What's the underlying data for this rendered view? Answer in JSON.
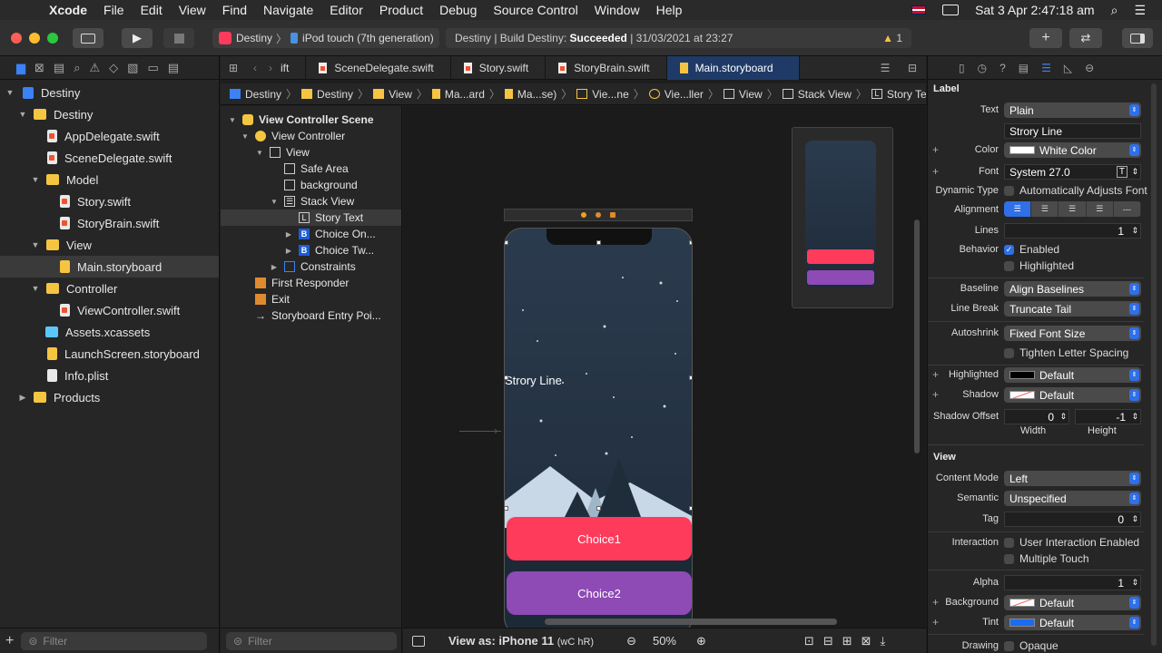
{
  "menu": {
    "app": "Xcode",
    "items": [
      "File",
      "Edit",
      "View",
      "Find",
      "Navigate",
      "Editor",
      "Product",
      "Debug",
      "Source Control",
      "Window",
      "Help"
    ],
    "clock": "Sat 3 Apr  2:47:18 am"
  },
  "toolbar": {
    "scheme": "Destiny",
    "device": "iPod touch (7th generation)",
    "status_prefix": "Destiny | Build Destiny: ",
    "status_bold": "Succeeded",
    "status_suffix": " | 31/03/2021 at 23:27",
    "warnings": "1"
  },
  "navigator": {
    "rows": [
      {
        "label": "Destiny",
        "level": 0,
        "icon": "xcodeproj",
        "open": true
      },
      {
        "label": "Destiny",
        "level": 1,
        "icon": "folder",
        "open": true
      },
      {
        "label": "AppDelegate.swift",
        "level": 2,
        "icon": "swift"
      },
      {
        "label": "SceneDelegate.swift",
        "level": 2,
        "icon": "swift"
      },
      {
        "label": "Model",
        "level": 1,
        "icon": "folder",
        "open": true
      },
      {
        "label": "Story.swift",
        "level": 2,
        "icon": "swift"
      },
      {
        "label": "StoryBrain.swift",
        "level": 2,
        "icon": "swift"
      },
      {
        "label": "View",
        "level": 1,
        "icon": "folder",
        "open": true
      },
      {
        "label": "Main.storyboard",
        "level": 2,
        "icon": "storyboard",
        "selected": true
      },
      {
        "label": "Controller",
        "level": 1,
        "icon": "folder",
        "open": true
      },
      {
        "label": "ViewController.swift",
        "level": 2,
        "icon": "swift"
      },
      {
        "label": "Assets.xcassets",
        "level": 1,
        "icon": "assets"
      },
      {
        "label": "LaunchScreen.storyboard",
        "level": 1,
        "icon": "storyboard"
      },
      {
        "label": "Info.plist",
        "level": 1,
        "icon": "plist"
      },
      {
        "label": "Products",
        "level": 0,
        "icon": "folder",
        "open": false
      }
    ],
    "filter_placeholder": "Filter"
  },
  "tabs": [
    "ift",
    "SceneDelegate.swift",
    "Story.swift",
    "StoryBrain.swift",
    "Main.storyboard"
  ],
  "breadcrumb": [
    "Destiny",
    "Destiny",
    "View",
    "Ma...ard",
    "Ma...se)",
    "Vie...ne",
    "Vie...ller",
    "View",
    "Stack View",
    "Story Text"
  ],
  "outline": {
    "rows": [
      {
        "label": "View Controller Scene",
        "level": 0,
        "bold": true,
        "icon": "scene"
      },
      {
        "label": "View Controller",
        "level": 1,
        "icon": "vc"
      },
      {
        "label": "View",
        "level": 2,
        "icon": "view"
      },
      {
        "label": "Safe Area",
        "level": 3,
        "icon": "safe"
      },
      {
        "label": "background",
        "level": 3,
        "icon": "image"
      },
      {
        "label": "Stack View",
        "level": 3,
        "icon": "stack"
      },
      {
        "label": "Story Text",
        "level": 4,
        "icon": "label",
        "selected": true
      },
      {
        "label": "Choice On...",
        "level": 4,
        "icon": "button",
        "collapsed": true
      },
      {
        "label": "Choice Tw...",
        "level": 4,
        "icon": "button",
        "collapsed": true
      },
      {
        "label": "Constraints",
        "level": 3,
        "icon": "constraints",
        "collapsed": true
      },
      {
        "label": "First Responder",
        "level": 1,
        "icon": "responder"
      },
      {
        "label": "Exit",
        "level": 1,
        "icon": "exit"
      },
      {
        "label": "Storyboard Entry Poi...",
        "level": 1,
        "icon": "entry"
      }
    ],
    "filter_placeholder": "Filter"
  },
  "canvas": {
    "story_label": "Strory Line",
    "choice1": "Choice1",
    "choice2": "Choice2",
    "choice1_color": "#ff3b5c",
    "choice2_color": "#8e4ab5",
    "view_as": "View as: iPhone 11",
    "size_class": "(wC hR)",
    "zoom": "50%"
  },
  "inspector": {
    "label_section": "Label",
    "text_type": "Plain",
    "text_value": "Strory Line",
    "color": "White Color",
    "font": "System 27.0",
    "dynamic_type": "Automatically Adjusts Font",
    "lines": "1",
    "behavior_enabled": "Enabled",
    "behavior_highlighted": "Highlighted",
    "baseline": "Align Baselines",
    "line_break": "Truncate Tail",
    "autoshrink": "Fixed Font Size",
    "tighten": "Tighten Letter Spacing",
    "highlighted": "Default",
    "shadow": "Default",
    "shadow_width": "0",
    "shadow_height": "-1",
    "view_section": "View",
    "content_mode": "Left",
    "semantic": "Unspecified",
    "tag": "0",
    "interaction_user": "User Interaction Enabled",
    "interaction_multi": "Multiple Touch",
    "alpha": "1",
    "background": "Default",
    "tint": "Default",
    "drawing": "Opaque",
    "labels": {
      "text": "Text",
      "color": "Color",
      "font": "Font",
      "dynamic_type": "Dynamic Type",
      "alignment": "Alignment",
      "lines": "Lines",
      "behavior": "Behavior",
      "baseline": "Baseline",
      "line_break": "Line Break",
      "autoshrink": "Autoshrink",
      "highlighted": "Highlighted",
      "shadow": "Shadow",
      "shadow_offset": "Shadow Offset",
      "width": "Width",
      "height": "Height",
      "content_mode": "Content Mode",
      "semantic": "Semantic",
      "tag": "Tag",
      "interaction": "Interaction",
      "alpha": "Alpha",
      "background": "Background",
      "tint": "Tint",
      "drawing": "Drawing"
    }
  }
}
